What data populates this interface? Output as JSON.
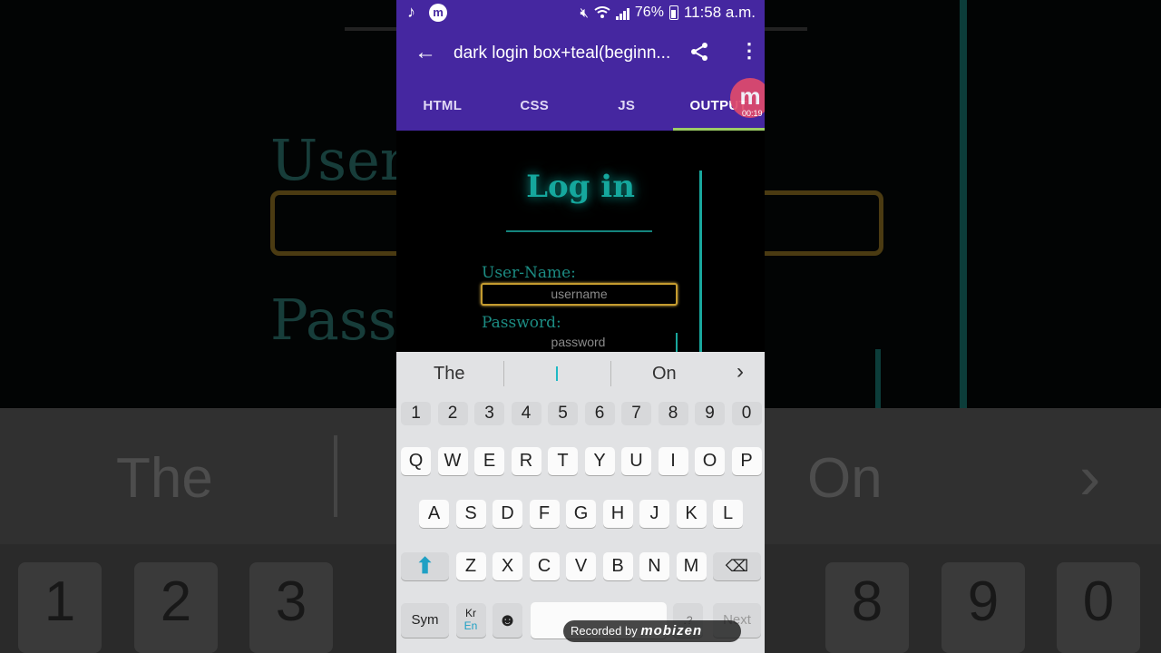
{
  "status": {
    "battery": "76%",
    "time": "11:58 a.m."
  },
  "appbar": {
    "title": "dark login box+teal(beginn..."
  },
  "tabs": [
    "HTML",
    "CSS",
    "JS",
    "OUTPUT"
  ],
  "recorder": {
    "badge": "m",
    "elapsed": "00:19",
    "label": "Recorded by",
    "brand": "mobizen"
  },
  "preview": {
    "heading": "Log in",
    "username_label": "User-Name:",
    "username_placeholder": "username",
    "password_label": "Password:",
    "password_placeholder": "password"
  },
  "suggestions": [
    "The",
    "I",
    "On"
  ],
  "keyboard": {
    "numbers": [
      "1",
      "2",
      "3",
      "4",
      "5",
      "6",
      "7",
      "8",
      "9",
      "0"
    ],
    "row1": [
      "Q",
      "W",
      "E",
      "R",
      "T",
      "Y",
      "U",
      "I",
      "O",
      "P"
    ],
    "row2": [
      "A",
      "S",
      "D",
      "F",
      "G",
      "H",
      "J",
      "K",
      "L"
    ],
    "row3": [
      "Z",
      "X",
      "C",
      "V",
      "B",
      "N",
      "M"
    ],
    "sym": "Sym",
    "lang_top": "Kr",
    "lang_bottom": "En",
    "next": "Next"
  },
  "colors": {
    "appbar": "#4527a0",
    "teal": "#15a79d",
    "gold": "#c49b2f",
    "accent": "#9ccc65"
  }
}
